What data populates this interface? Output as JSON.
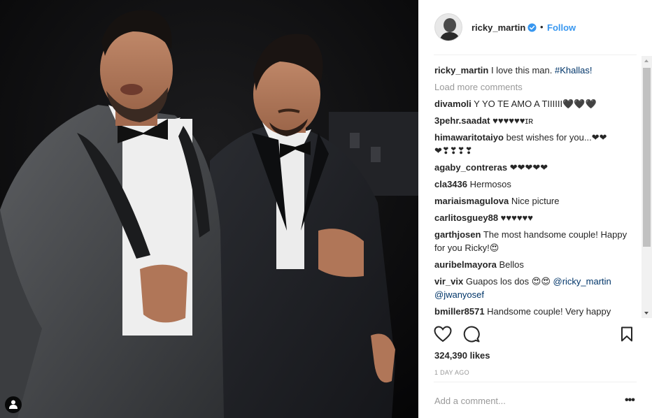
{
  "post": {
    "username": "ricky_martin",
    "follow_label": "Follow",
    "dot": "•",
    "likes": "324,390 likes",
    "time_ago": "1 DAY AGO",
    "add_comment_placeholder": "Add a comment...",
    "more_options": "•••"
  },
  "caption": {
    "user": "ricky_martin",
    "text": "I love this man. ",
    "hashtag": "#Khallas!"
  },
  "load_more": "Load more comments",
  "comments": [
    {
      "user": "divamoli",
      "text": "Y YO TE AMO A TIIIIII🖤🖤🖤"
    },
    {
      "user": "3pehr.saadat",
      "text": "♥♥♥♥♥♥ɪʀ"
    },
    {
      "user": "himawaritotaiyo",
      "text": "best wishes for you...❤❤ ❤❣❣❣❣"
    },
    {
      "user": "agaby_contreras",
      "text": "❤❤❤❤❤"
    },
    {
      "user": "cla3436",
      "text": "Hermosos"
    },
    {
      "user": "mariaismagulova",
      "text": "Nice picture"
    },
    {
      "user": "carlitosguey88",
      "text": "♥♥♥♥♥♥"
    },
    {
      "user": "garthjosen",
      "text": "The most handsome couple! Happy for you Ricky!😍"
    },
    {
      "user": "auribelmayora",
      "text": "Bellos"
    },
    {
      "user": "vir_vix",
      "text": "Guapos los dos 😍😍 ",
      "mentions": [
        "@ricky_martin",
        "@jwanyosef"
      ]
    },
    {
      "user": "bmiller8571",
      "text": "Handsome couple! Very happy"
    }
  ],
  "icons": {
    "like": "heart-icon",
    "comment": "comment-icon",
    "save": "bookmark-icon",
    "verified": "verified-badge-icon",
    "user_tag": "person-icon"
  },
  "colors": {
    "link": "#3897f0",
    "mention": "#003569",
    "muted": "#999999",
    "text": "#262626"
  }
}
